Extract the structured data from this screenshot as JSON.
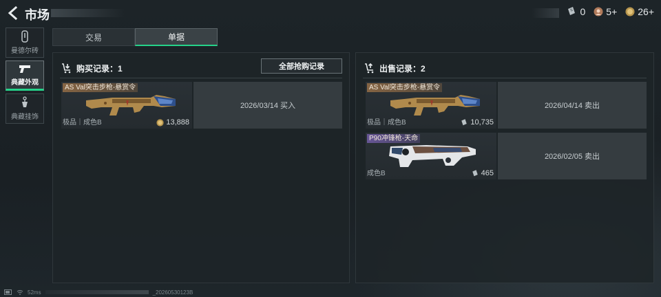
{
  "header": {
    "title": "市场",
    "currencies": [
      {
        "icon": "ticket-icon",
        "value": "0"
      },
      {
        "icon": "badge-coin-icon",
        "value": "5+"
      },
      {
        "icon": "gold-coin-icon",
        "value": "26+"
      }
    ]
  },
  "sidebar": {
    "items": [
      {
        "label": "曼德尔砖",
        "icon": "brick-icon",
        "active": false
      },
      {
        "label": "典藏外观",
        "icon": "pistol-icon",
        "active": true
      },
      {
        "label": "典藏挂饰",
        "icon": "charm-icon",
        "active": false
      }
    ]
  },
  "tabs": [
    {
      "label": "交易",
      "active": false
    },
    {
      "label": "单据",
      "active": true
    }
  ],
  "buy_panel": {
    "header": "购买记录：1",
    "all_button": "全部抢购记录",
    "records": [
      {
        "item_name": "AS Val突击步枪-悬赏令",
        "quality": "极品｜成色B",
        "price": "13,888",
        "price_icon": "gold-coin-icon",
        "info": "2026/03/14 买入"
      }
    ]
  },
  "sell_panel": {
    "header": "出售记录：2",
    "records": [
      {
        "item_name": "AS Val突击步枪-悬赏令",
        "quality": "极品｜成色B",
        "price": "10,735",
        "price_icon": "ticket-icon",
        "info": "2026/04/14 卖出"
      },
      {
        "item_name": "P90冲锋枪-天命",
        "quality": "成色B",
        "price": "465",
        "price_icon": "ticket-icon",
        "info": "2026/02/05 卖出"
      }
    ]
  },
  "footer": {
    "ping": "52ms",
    "build": "_20260530123B"
  },
  "colors": {
    "accent": "#25d38a",
    "gold_tag": "#966e46",
    "purple_tag": "#6e5aa0"
  }
}
